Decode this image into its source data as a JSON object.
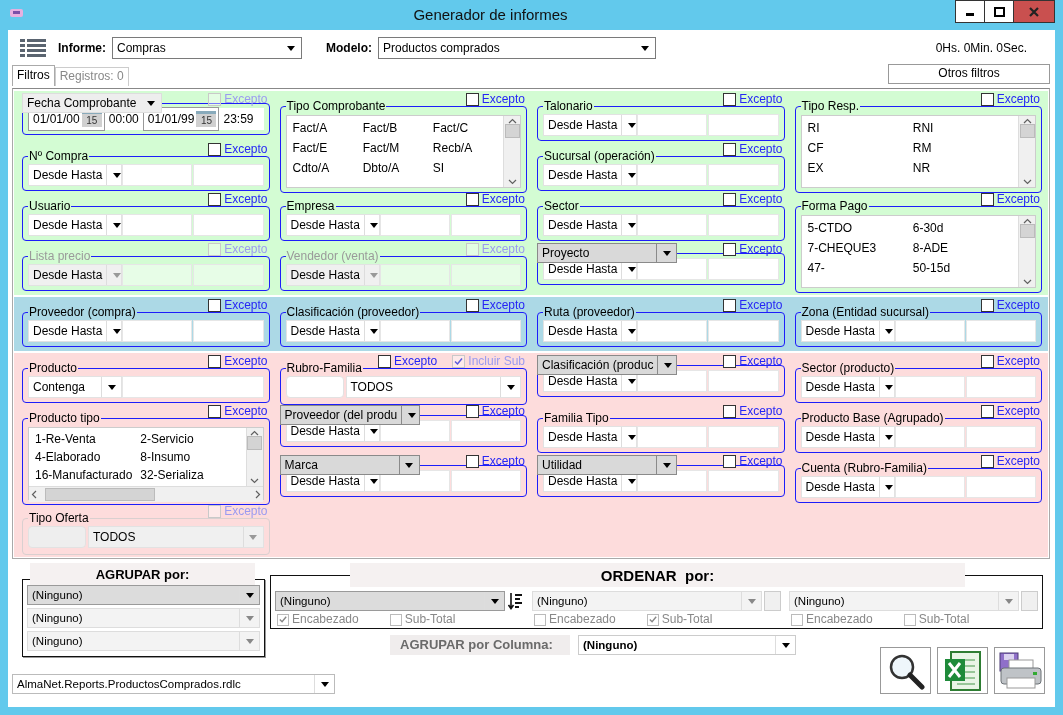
{
  "window": {
    "title": "Generador de informes"
  },
  "toolbar": {
    "informe_label": "Informe:",
    "informe_value": "Compras",
    "modelo_label": "Modelo:",
    "modelo_value": "Productos comprados",
    "timer": "0Hs. 0Min. 0Sec."
  },
  "tabs": [
    {
      "label": "Filtros",
      "selected": true
    },
    {
      "label": "Registros: 0",
      "selected": false
    }
  ],
  "other_filters_button": "Otros filtros",
  "sections": [
    {
      "color": "#d3fcd3",
      "filters": [
        {
          "kind": "date",
          "label": "Fecha Comprobante",
          "label_dropdown": true,
          "disabled": false,
          "checks": [
            {
              "label": "Excepto",
              "checked": false,
              "disabled": true
            }
          ],
          "dates": [
            {
              "value": "01/01/00",
              "day": "15",
              "time": "00:00"
            },
            {
              "value": "01/01/99",
              "day": "15",
              "time": "23:59"
            }
          ]
        },
        {
          "kind": "list",
          "label": "Tipo Comprobante",
          "label_dropdown": false,
          "disabled": false,
          "horizontal_scrollbar": false,
          "checks": [
            {
              "label": "Excepto",
              "checked": false,
              "disabled": false
            }
          ],
          "rows": [
            [
              "Fact/A",
              "Fact/B",
              "Fact/C"
            ],
            [
              "Fact/E",
              "Fact/M",
              "Recb/A"
            ],
            [
              "Cdto/A",
              "Dbto/A",
              "SI"
            ]
          ]
        },
        {
          "kind": "range",
          "label": "Talonario",
          "label_dropdown": false,
          "disabled": false,
          "mode": "Desde Hasta",
          "checks": [
            {
              "label": "Excepto",
              "checked": false,
              "disabled": false
            }
          ]
        },
        {
          "kind": "list",
          "label": "Tipo Resp.",
          "label_dropdown": false,
          "disabled": false,
          "horizontal_scrollbar": false,
          "checks": [
            {
              "label": "Excepto",
              "checked": false,
              "disabled": false
            }
          ],
          "rows": [
            [
              "RI",
              "RNI"
            ],
            [
              "CF",
              "RM"
            ],
            [
              "EX",
              "NR"
            ]
          ]
        },
        {
          "kind": "range",
          "label": "Nº Compra",
          "label_dropdown": false,
          "disabled": false,
          "mode": "Desde Hasta",
          "checks": [
            {
              "label": "Excepto",
              "checked": false,
              "disabled": false
            }
          ]
        },
        {
          "kind": "range",
          "label": "Sucursal (operación)",
          "label_dropdown": false,
          "disabled": false,
          "mode": "Desde Hasta",
          "checks": [
            {
              "label": "Excepto",
              "checked": false,
              "disabled": false
            }
          ]
        },
        {
          "kind": "range",
          "label": "Usuario",
          "label_dropdown": false,
          "disabled": false,
          "mode": "Desde Hasta",
          "checks": [
            {
              "label": "Excepto",
              "checked": false,
              "disabled": false
            }
          ]
        },
        {
          "kind": "range",
          "label": "Empresa",
          "label_dropdown": false,
          "disabled": false,
          "mode": "Desde Hasta",
          "checks": [
            {
              "label": "Excepto",
              "checked": false,
              "disabled": false
            }
          ]
        },
        {
          "kind": "range",
          "label": "Sector",
          "label_dropdown": false,
          "disabled": false,
          "mode": "Desde Hasta",
          "checks": [
            {
              "label": "Excepto",
              "checked": false,
              "disabled": false
            }
          ]
        },
        {
          "kind": "list",
          "label": "Forma Pago",
          "label_dropdown": false,
          "disabled": false,
          "horizontal_scrollbar": false,
          "checks": [
            {
              "label": "Excepto",
              "checked": false,
              "disabled": false
            }
          ],
          "rows": [
            [
              "5-CTDO",
              "6-30d"
            ],
            [
              "7-CHEQUE3",
              "8-ADE"
            ],
            [
              "47-",
              "50-15d"
            ]
          ]
        },
        {
          "kind": "range",
          "label": "Lista precio",
          "label_dropdown": false,
          "disabled": true,
          "mode": "Desde Hasta",
          "checks": [
            {
              "label": "Excepto",
              "checked": false,
              "disabled": true
            }
          ]
        },
        {
          "kind": "range",
          "label": "Vendedor (venta)",
          "label_dropdown": false,
          "disabled": true,
          "mode": "Desde Hasta",
          "checks": [
            {
              "label": "Excepto",
              "checked": false,
              "disabled": true
            }
          ]
        },
        {
          "kind": "range",
          "label": "Proyecto",
          "label_dropdown": true,
          "disabled": false,
          "mode": "Desde Hasta",
          "checks": [
            {
              "label": "Excepto",
              "checked": false,
              "disabled": false
            }
          ]
        }
      ]
    },
    {
      "color": "#acd9e6",
      "filters": [
        {
          "kind": "range",
          "label": "Proveedor (compra)",
          "label_dropdown": false,
          "disabled": false,
          "mode": "Desde Hasta",
          "checks": [
            {
              "label": "Excepto",
              "checked": false,
              "disabled": false
            }
          ]
        },
        {
          "kind": "range",
          "label": "Clasificación (proveedor)",
          "label_dropdown": false,
          "disabled": false,
          "mode": "Desde Hasta",
          "checks": [
            {
              "label": "Excepto",
              "checked": false,
              "disabled": false
            }
          ]
        },
        {
          "kind": "range",
          "label": "Ruta (proveedor)",
          "label_dropdown": false,
          "disabled": false,
          "mode": "Desde Hasta",
          "checks": [
            {
              "label": "Excepto",
              "checked": false,
              "disabled": false
            }
          ]
        },
        {
          "kind": "range",
          "label": "Zona (Entidad sucursal)",
          "label_dropdown": false,
          "disabled": false,
          "mode": "Desde Hasta",
          "checks": [
            {
              "label": "Excepto",
              "checked": false,
              "disabled": false
            }
          ]
        }
      ]
    },
    {
      "color": "#fddcdc",
      "filters": [
        {
          "kind": "text",
          "label": "Producto",
          "label_dropdown": false,
          "disabled": false,
          "mode": "Contenga",
          "checks": [
            {
              "label": "Excepto",
              "checked": false,
              "disabled": false
            }
          ]
        },
        {
          "kind": "select",
          "label": "Rubro-Familia",
          "label_dropdown": false,
          "disabled": false,
          "value": "TODOS",
          "checks": [
            {
              "label": "Excepto",
              "checked": false,
              "disabled": false
            },
            {
              "label": "Incluir Sub",
              "checked": true,
              "disabled": true
            }
          ]
        },
        {
          "kind": "range",
          "label": "Clasificación (produc",
          "label_dropdown": true,
          "disabled": false,
          "mode": "Desde Hasta",
          "checks": [
            {
              "label": "Excepto",
              "checked": false,
              "disabled": false
            }
          ]
        },
        {
          "kind": "range",
          "label": "Sector (producto)",
          "label_dropdown": false,
          "disabled": false,
          "mode": "Desde Hasta",
          "checks": [
            {
              "label": "Excepto",
              "checked": false,
              "disabled": false
            }
          ]
        },
        {
          "kind": "list",
          "label": "Producto tipo",
          "label_dropdown": false,
          "disabled": false,
          "horizontal_scrollbar": true,
          "checks": [
            {
              "label": "Excepto",
              "checked": false,
              "disabled": false
            }
          ],
          "rows": [
            [
              "1-Re-Venta",
              "2-Servicio"
            ],
            [
              "4-Elaborado",
              "8-Insumo"
            ],
            [
              "16-Manufacturado",
              "32-Serializa"
            ]
          ]
        },
        {
          "kind": "range",
          "label": "Proveedor (del produ",
          "label_dropdown": true,
          "disabled": false,
          "mode": "Desde Hasta",
          "checks": [
            {
              "label": "Excepto",
              "checked": false,
              "disabled": false
            }
          ]
        },
        {
          "kind": "range",
          "label": "Familia Tipo",
          "label_dropdown": false,
          "disabled": false,
          "mode": "Desde Hasta",
          "checks": [
            {
              "label": "Excepto",
              "checked": false,
              "disabled": false
            }
          ]
        },
        {
          "kind": "range",
          "label": "Producto Base (Agrupado)",
          "label_dropdown": false,
          "disabled": false,
          "mode": "Desde Hasta",
          "checks": [
            {
              "label": "Excepto",
              "checked": false,
              "disabled": false
            }
          ]
        },
        {
          "kind": "range",
          "label": "Marca",
          "label_dropdown": true,
          "disabled": false,
          "mode": "Desde Hasta",
          "checks": [
            {
              "label": "Excepto",
              "checked": false,
              "disabled": false
            }
          ]
        },
        {
          "kind": "range",
          "label": "Utilidad",
          "label_dropdown": true,
          "disabled": false,
          "mode": "Desde Hasta",
          "checks": [
            {
              "label": "Excepto",
              "checked": false,
              "disabled": false
            }
          ]
        },
        {
          "kind": "range",
          "label": "Cuenta (Rubro-Familia)",
          "label_dropdown": false,
          "disabled": false,
          "mode": "Desde Hasta",
          "checks": [
            {
              "label": "Excepto",
              "checked": false,
              "disabled": false
            }
          ]
        },
        {
          "kind": "select",
          "label": "Tipo Oferta",
          "label_dropdown": false,
          "disabled": true,
          "value": "TODOS",
          "checks": [
            {
              "label": "Excepto",
              "checked": false,
              "disabled": true
            }
          ]
        }
      ]
    }
  ],
  "group_by": {
    "title": "AGRUPAR por:",
    "combos": [
      {
        "value": "(Ninguno)",
        "enabled": true
      },
      {
        "value": "(Ninguno)",
        "enabled": false
      },
      {
        "value": "(Ninguno)",
        "enabled": false
      }
    ]
  },
  "order_by": {
    "title": "ORDENAR  por:",
    "columns": [
      {
        "value": "(Ninguno)",
        "enabled": true,
        "checks": [
          {
            "label": "Encabezado",
            "checked": true
          },
          {
            "label": "Sub-Total",
            "checked": false
          }
        ]
      },
      {
        "value": "(Ninguno)",
        "enabled": false,
        "checks": [
          {
            "label": "Encabezado",
            "checked": false
          },
          {
            "label": "Sub-Total",
            "checked": true
          }
        ]
      },
      {
        "value": "(Ninguno)",
        "enabled": false,
        "checks": [
          {
            "label": "Encabezado",
            "checked": false
          },
          {
            "label": "Sub-Total",
            "checked": false
          }
        ]
      }
    ]
  },
  "group_by_column": {
    "label": "AGRUPAR por Columna:",
    "value": "(Ninguno)"
  },
  "report_file": "AlmaNet.Reports.ProductosComprados.rdlc"
}
